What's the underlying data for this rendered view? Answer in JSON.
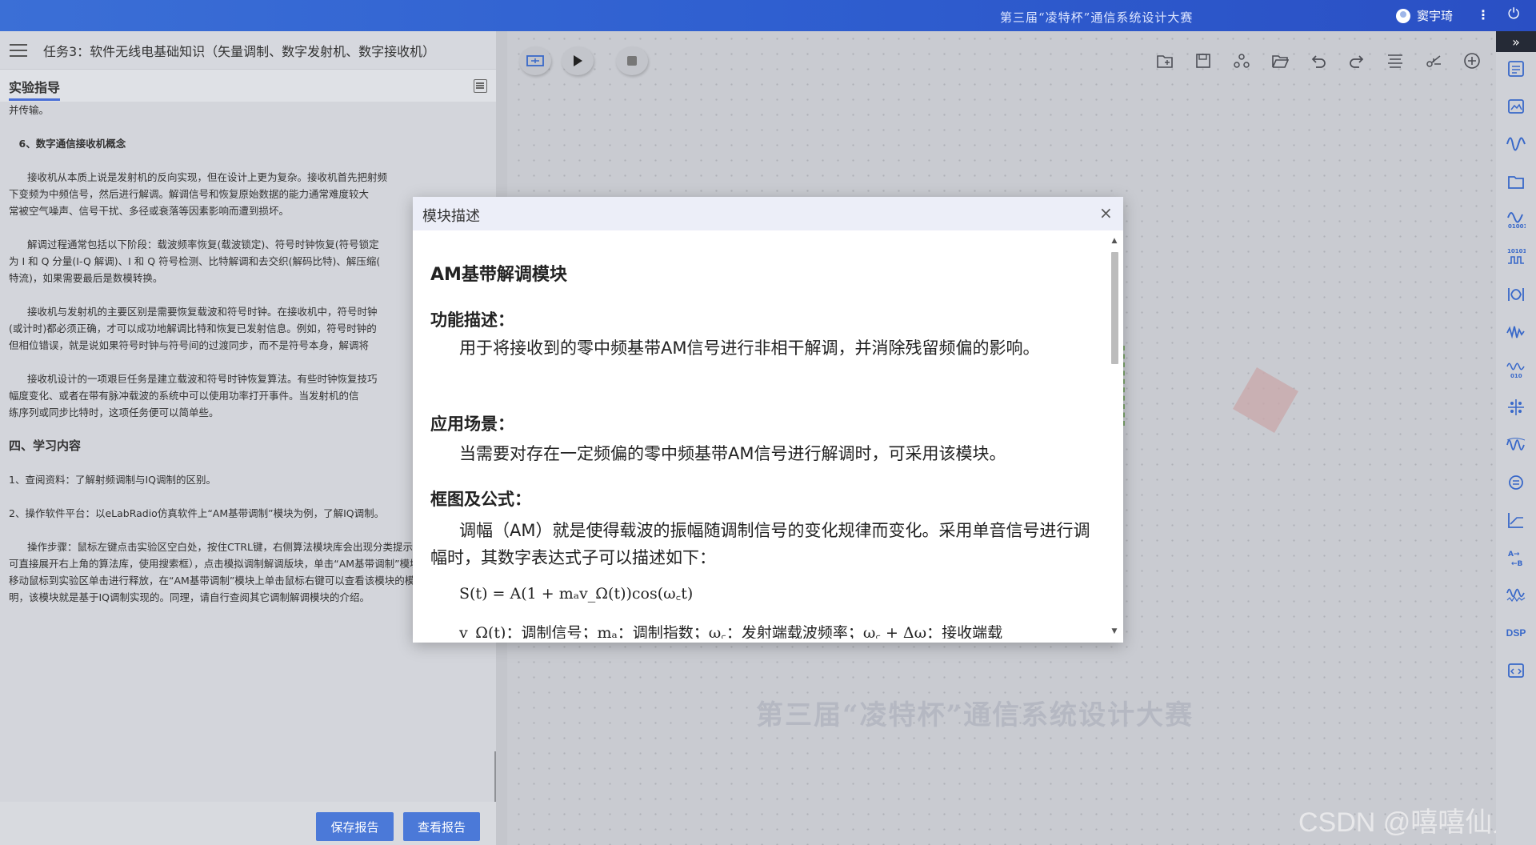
{
  "topbar": {
    "contest_title": "第三届“凌特杯”通信系统设计大赛",
    "user_name": "窦宇琦",
    "more_glyph": "⋮",
    "power_glyph": "⏻"
  },
  "left": {
    "task_title": "任务3：软件无线电基础知识（矢量调制、数字发射机、数字接收机）",
    "tab_label": "实验指导",
    "doc": [
      {
        "cls": "",
        "text": "并传输。"
      },
      {
        "cls": "gap",
        "text": ""
      },
      {
        "cls": "b",
        "text": "　6、数字通信接收机概念"
      },
      {
        "cls": "gap",
        "text": ""
      },
      {
        "cls": "ind",
        "text": "接收机从本质上说是发射机的反向实现，但在设计上更为复杂。接收机首先把射频"
      },
      {
        "cls": "",
        "text": "下变频为中频信号，然后进行解调。解调信号和恢复原始数据的能力通常难度较大"
      },
      {
        "cls": "",
        "text": "常被空气噪声、信号干扰、多径或衰落等因素影响而遭到损坏。"
      },
      {
        "cls": "gap",
        "text": ""
      },
      {
        "cls": "ind",
        "text": "解调过程通常包括以下阶段：载波频率恢复(载波锁定)、符号时钟恢复(符号锁定"
      },
      {
        "cls": "",
        "text": "为 I 和 Q 分量(I-Q 解调)、I 和 Q 符号检测、比特解调和去交织(解码比特)、解压缩("
      },
      {
        "cls": "",
        "text": "特流)，如果需要最后是数模转换。"
      },
      {
        "cls": "gap",
        "text": ""
      },
      {
        "cls": "ind",
        "text": "接收机与发射机的主要区别是需要恢复载波和符号时钟。在接收机中，符号时钟"
      },
      {
        "cls": "",
        "text": "(或计时)都必须正确，才可以成功地解调比特和恢复已发射信息。例如，符号时钟的"
      },
      {
        "cls": "",
        "text": "但相位错误，就是说如果符号时钟与符号间的过渡同步，而不是符号本身，解调将"
      },
      {
        "cls": "gap",
        "text": ""
      },
      {
        "cls": "ind",
        "text": "接收机设计的一项艰巨任务是建立载波和符号时钟恢复算法。有些时钟恢复技巧"
      },
      {
        "cls": "",
        "text": "幅度变化、或者在带有脉冲载波的系统中可以使用功率打开事件。当发射机的信"
      },
      {
        "cls": "",
        "text": "练序列或同步比特时，这项任务便可以简单些。"
      },
      {
        "cls": "gap",
        "text": ""
      },
      {
        "cls": "h4",
        "text": "四、学习内容"
      },
      {
        "cls": "gap",
        "text": ""
      },
      {
        "cls": "b2",
        "text": " 1、查阅资料：了解射频调制与IQ调制的区别。"
      },
      {
        "cls": "gap",
        "text": ""
      },
      {
        "cls": "b2",
        "text": "2、操作软件平台：以eLabRadio仿真软件上“AM基带调制”模块为例，了解IQ调制。"
      },
      {
        "cls": "gap",
        "text": ""
      },
      {
        "cls": "ind",
        "text": "操作步骤：鼠标左键点击实验区空白处，按住CTRL键，右侧算法模块库会出现分类提示（也"
      },
      {
        "cls": "",
        "text": "可直接展开右上角的算法库，使用搜索框），点击模拟调制解调版块，单击“AM基带调制”模块后"
      },
      {
        "cls": "",
        "text": "移动鼠标到实验区单击进行释放，在“AM基带调制”模块上单击鼠标右键可以查看该模块的模块说"
      },
      {
        "cls": "",
        "text": "明，该模块就是基于IQ调制实现的。同理，请自行查阅其它调制解调模块的介绍。"
      }
    ],
    "save_report": "保存报告",
    "view_report": "查看报告"
  },
  "canvas": {
    "watermark": "第三届“凌特杯”通信系统设计大赛",
    "csdn_mark": "CSDN @嘻嘻仙人"
  },
  "modal": {
    "header_title": "模块描述",
    "close_glyph": "×",
    "module_title": "AM基带解调模块",
    "section_function": "功能描述：",
    "function_text": "用于将接收到的零中频基带AM信号进行非相干解调，并消除残留频偏的影响。",
    "section_scenario": "应用场景：",
    "scenario_text": "当需要对存在一定频偏的零中频基带AM信号进行解调时，可采用该模块。",
    "section_formula": "框图及公式：",
    "formula_text": "调幅（AM）就是使得载波的振幅随调制信号的变化规律而变化。采用单音信号进行调幅时，其数字表达式子可以描述如下：",
    "formula": "S(t) = A(1 + mₐv_Ω(t))cos(ω꜀t)",
    "formula_cont": "v_Ω(t)：调制信号；mₐ：调制指数；ω꜀：发射端载波频率；ω꜀ + Δω：接收端载"
  },
  "rightbar": {
    "collapse_glyph": "»",
    "dsp_label": "DSP"
  }
}
